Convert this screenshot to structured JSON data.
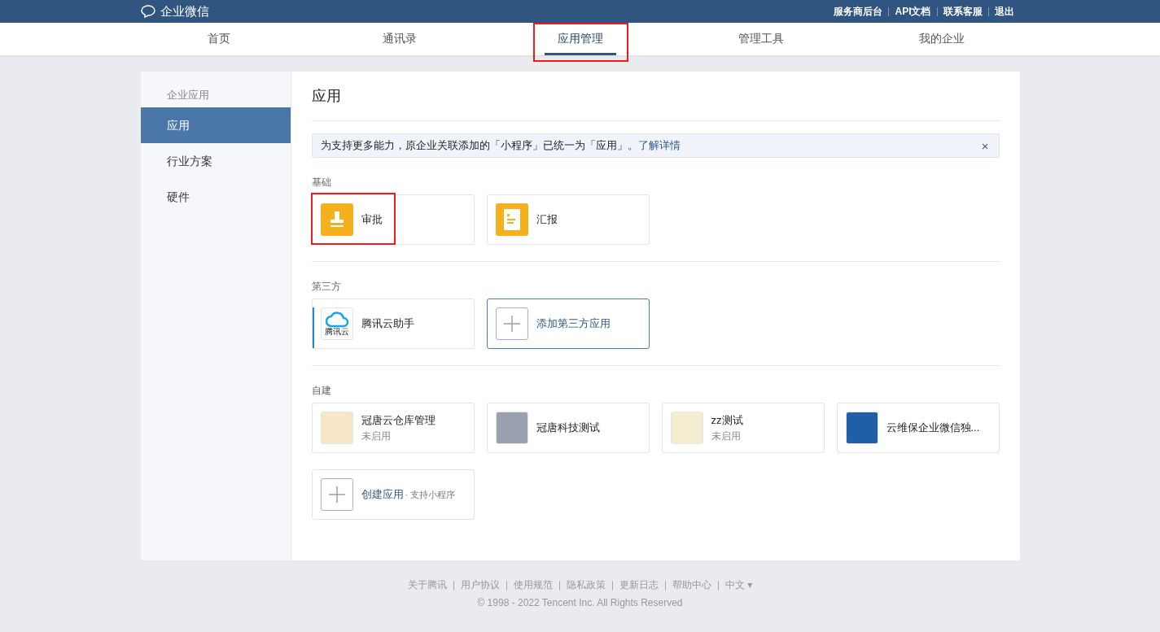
{
  "header": {
    "logo": "企业微信",
    "links": [
      "服务商后台",
      "API文档",
      "联系客服",
      "退出"
    ]
  },
  "nav": [
    {
      "label": "首页",
      "selected": false,
      "highlighted": false
    },
    {
      "label": "通讯录",
      "selected": false,
      "highlighted": false
    },
    {
      "label": "应用管理",
      "selected": true,
      "highlighted": true
    },
    {
      "label": "管理工具",
      "selected": false,
      "highlighted": false
    },
    {
      "label": "我的企业",
      "selected": false,
      "highlighted": false
    }
  ],
  "sidebar": {
    "heading": "企业应用",
    "items": [
      {
        "label": "应用",
        "selected": true
      },
      {
        "label": "行业方案",
        "selected": false
      },
      {
        "label": "硬件",
        "selected": false
      }
    ]
  },
  "page_title": "应用",
  "notice": {
    "text": "为支持更多能力，原企业关联添加的「小程序」已统一为「应用」。",
    "link": "了解详情",
    "close": "×"
  },
  "sections": [
    {
      "title": "基础",
      "apps": [
        {
          "kind": "approval",
          "name": "审批",
          "highlighted": true
        },
        {
          "kind": "report",
          "name": "汇报",
          "highlighted": false
        }
      ]
    },
    {
      "title": "第三方",
      "apps": [
        {
          "kind": "cloud",
          "name": "腾讯云助手",
          "icon_label": "腾讯云",
          "highlighted": false
        },
        {
          "kind": "add",
          "name": "添加第三方应用",
          "highlighted": false
        }
      ]
    },
    {
      "title": "自建",
      "apps": [
        {
          "kind": "image",
          "name": "冠唐云仓库管理",
          "status": "未启用",
          "color": "#f7e6c8",
          "highlighted": false
        },
        {
          "kind": "image",
          "name": "冠唐科技测试",
          "color": "#9aa0b0",
          "highlighted": false
        },
        {
          "kind": "image",
          "name": "zz测试",
          "status": "未启用",
          "color": "#f5edd0",
          "highlighted": false
        },
        {
          "kind": "image",
          "name": "云维保企业微信独...",
          "color": "#1f5fa8",
          "highlighted": false
        },
        {
          "kind": "create",
          "name": "创建应用",
          "note": "· 支持小程序",
          "highlighted": false
        }
      ]
    }
  ],
  "footer": {
    "links": [
      "关于腾讯",
      "用户协议",
      "使用规范",
      "隐私政策",
      "更新日志",
      "帮助中心",
      "中文 ▾"
    ],
    "copyright": "© 1998 - 2022 Tencent Inc. All Rights Reserved"
  }
}
